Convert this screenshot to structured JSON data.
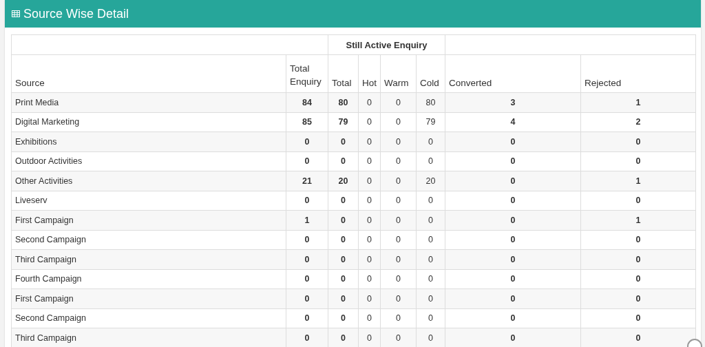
{
  "panel": {
    "title": "Source Wise Detail"
  },
  "table": {
    "group_header": "Still Active Enquiry",
    "columns": [
      "Source",
      "Total Enquiry",
      "Total",
      "Hot",
      "Warm",
      "Cold",
      "Converted",
      "Rejected"
    ],
    "rows": [
      {
        "source": "Print Media",
        "values": [
          "84",
          "80",
          "0",
          "0",
          "80",
          "3",
          "1"
        ]
      },
      {
        "source": "Digital Marketing",
        "values": [
          "85",
          "79",
          "0",
          "0",
          "79",
          "4",
          "2"
        ]
      },
      {
        "source": "Exhibitions",
        "values": [
          "0",
          "0",
          "0",
          "0",
          "0",
          "0",
          "0"
        ]
      },
      {
        "source": "Outdoor Activities",
        "values": [
          "0",
          "0",
          "0",
          "0",
          "0",
          "0",
          "0"
        ]
      },
      {
        "source": "Other Activities",
        "values": [
          "21",
          "20",
          "0",
          "0",
          "20",
          "0",
          "1"
        ]
      },
      {
        "source": "Liveserv",
        "values": [
          "0",
          "0",
          "0",
          "0",
          "0",
          "0",
          "0"
        ]
      },
      {
        "source": "First Campaign",
        "values": [
          "1",
          "0",
          "0",
          "0",
          "0",
          "0",
          "1"
        ]
      },
      {
        "source": "Second Campaign",
        "values": [
          "0",
          "0",
          "0",
          "0",
          "0",
          "0",
          "0"
        ]
      },
      {
        "source": "Third Campaign",
        "values": [
          "0",
          "0",
          "0",
          "0",
          "0",
          "0",
          "0"
        ]
      },
      {
        "source": "Fourth Campaign",
        "values": [
          "0",
          "0",
          "0",
          "0",
          "0",
          "0",
          "0"
        ]
      },
      {
        "source": "First Campaign",
        "values": [
          "0",
          "0",
          "0",
          "0",
          "0",
          "0",
          "0"
        ]
      },
      {
        "source": "Second Campaign",
        "values": [
          "0",
          "0",
          "0",
          "0",
          "0",
          "0",
          "0"
        ]
      },
      {
        "source": "Third Campaign",
        "values": [
          "0",
          "0",
          "0",
          "0",
          "0",
          "0",
          "0"
        ]
      }
    ]
  }
}
